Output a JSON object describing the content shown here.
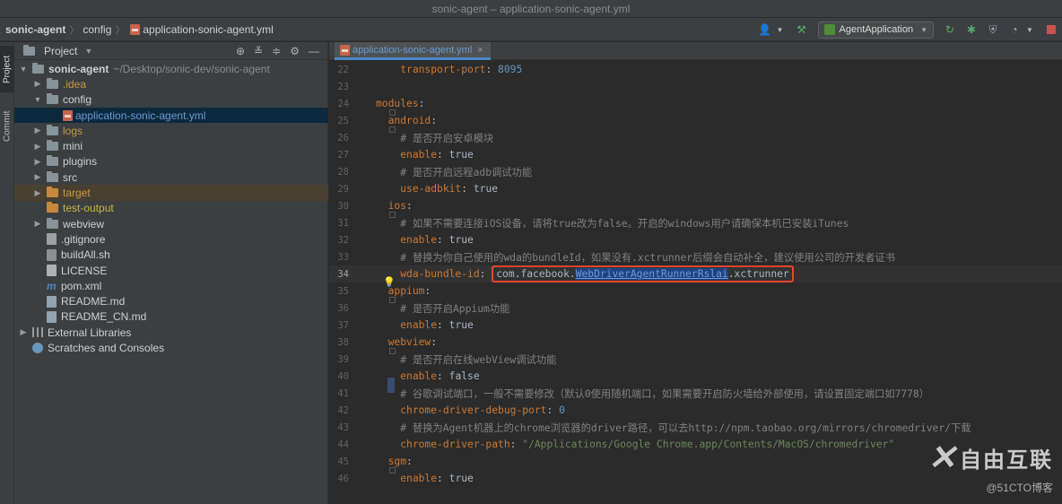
{
  "window": {
    "title": "sonic-agent – application-sonic-agent.yml"
  },
  "breadcrumb": [
    "sonic-agent",
    "config",
    "application-sonic-agent.yml"
  ],
  "toolbar": {
    "run_config": "AgentApplication"
  },
  "side_stripe": {
    "project_tab": "Project",
    "commit_tab": "Commit"
  },
  "project_panel": {
    "title": "Project",
    "root": {
      "name": "sonic-agent",
      "path": "~/Desktop/sonic-dev/sonic-agent"
    },
    "items": [
      {
        "label": ".idea"
      },
      {
        "label": "config"
      },
      {
        "label": "application-sonic-agent.yml"
      },
      {
        "label": "logs"
      },
      {
        "label": "mini"
      },
      {
        "label": "plugins"
      },
      {
        "label": "src"
      },
      {
        "label": "target"
      },
      {
        "label": "test-output"
      },
      {
        "label": "webview"
      },
      {
        "label": ".gitignore"
      },
      {
        "label": "buildAll.sh"
      },
      {
        "label": "LICENSE"
      },
      {
        "label": "pom.xml"
      },
      {
        "label": "README.md"
      },
      {
        "label": "README_CN.md"
      },
      {
        "label": "External Libraries"
      },
      {
        "label": "Scratches and Consoles"
      }
    ]
  },
  "editor": {
    "tab_label": "application-sonic-agent.yml",
    "lines": [
      {
        "n": "22",
        "key": "transport-port",
        "val": "8095"
      },
      {
        "n": "23"
      },
      {
        "n": "24",
        "key": "modules"
      },
      {
        "n": "25",
        "key": "android"
      },
      {
        "n": "26",
        "comment": "# 是否开启安卓模块"
      },
      {
        "n": "27",
        "key": "enable",
        "val": "true"
      },
      {
        "n": "28",
        "comment": "# 是否开启远程adb调试功能"
      },
      {
        "n": "29",
        "key": "use-adbkit",
        "val": "true"
      },
      {
        "n": "30",
        "key": "ios"
      },
      {
        "n": "31",
        "comment": "# 如果不需要连接iOS设备，请将true改为false。开启的windows用户请确保本机已安装iTunes"
      },
      {
        "n": "32",
        "key": "enable",
        "val": "true"
      },
      {
        "n": "33",
        "comment": "# 替换为你自己使用的wda的bundleId，如果没有.xctrunner后缀会自动补全，建议使用公司的开发者证书"
      },
      {
        "n": "34",
        "key": "wda-bundle-id",
        "val_pre": "com.facebook.",
        "val_sel": "WebDriverAgentRunnerRslai",
        "val_post": ".xctrunner"
      },
      {
        "n": "35",
        "key": "appium"
      },
      {
        "n": "36",
        "comment": "# 是否开启Appium功能"
      },
      {
        "n": "37",
        "key": "enable",
        "val": "true"
      },
      {
        "n": "38",
        "key": "webview"
      },
      {
        "n": "39",
        "comment": "# 是否开启在线webView调试功能"
      },
      {
        "n": "40",
        "key": "enable",
        "val": "false"
      },
      {
        "n": "41",
        "comment": "# 谷歌调试端口，一般不需要修改（默认0使用随机端口，如果需要开启防火墙给外部使用，请设置固定端口如7778）"
      },
      {
        "n": "42",
        "key": "chrome-driver-debug-port",
        "val": "0"
      },
      {
        "n": "43",
        "comment": "# 替换为Agent机器上的chrome浏览器的driver路径，可以去http://npm.taobao.org/mirrors/chromedriver/下载"
      },
      {
        "n": "44",
        "key": "chrome-driver-path",
        "str": "\"/Applications/Google Chrome.app/Contents/MacOS/chromedriver\""
      },
      {
        "n": "45",
        "key": "sgm"
      },
      {
        "n": "46",
        "key": "enable",
        "val": "true"
      }
    ]
  },
  "watermark": {
    "brand": "自由互联",
    "sub": "@51CTO博客"
  },
  "colors": {
    "highlight_box": "#e8452e",
    "selection": "#214283",
    "keyword": "#cc7832",
    "comment": "#808080"
  }
}
